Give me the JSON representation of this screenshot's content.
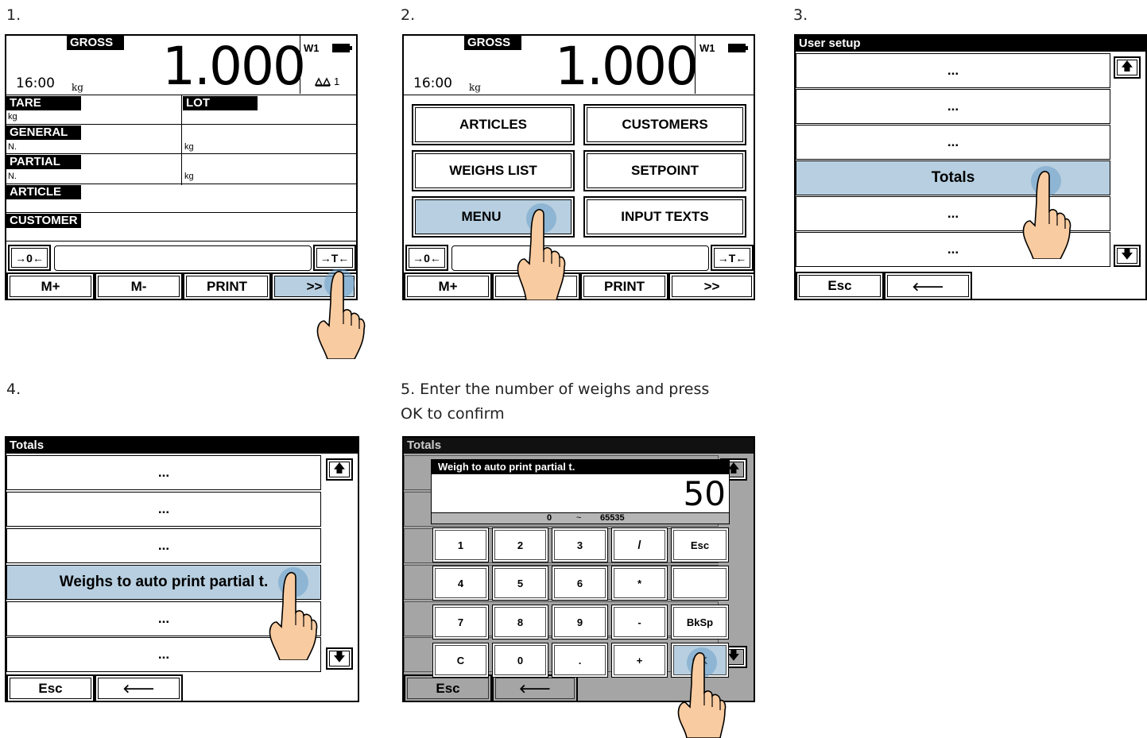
{
  "steps": {
    "s1": "1.",
    "s2": "2.",
    "s3": "3.",
    "s4": "4.",
    "s5_line1": "5. Enter the number of weighs and press",
    "s5_line2": "OK to confirm"
  },
  "screen1": {
    "gross_label": "GROSS",
    "weight": "1.000",
    "unit": "kg",
    "time": "16:00",
    "channel": "W1",
    "scale_number": "1",
    "tare_label": "TARE",
    "tare_unit": "kg",
    "lot_label": "LOT",
    "general_label": "GENERAL",
    "general_n": "N.",
    "general_kg": "kg",
    "partial_label": "PARTIAL",
    "partial_n": "N.",
    "partial_kg": "kg",
    "article_label": "ARTICLE",
    "customer_label": "CUSTOMER",
    "zero_btn": "→0←",
    "tare_btn": "→T←",
    "softkeys": [
      "M+",
      "M-",
      "PRINT",
      ">>"
    ]
  },
  "screen2": {
    "gross_label": "GROSS",
    "weight": "1.000",
    "unit": "kg",
    "time": "16:00",
    "channel": "W1",
    "menu_buttons": [
      "ARTICLES",
      "CUSTOMERS",
      "WEIGHS LIST",
      "SETPOINT",
      "MENU",
      "INPUT TEXTS"
    ],
    "zero_btn": "→0←",
    "tare_btn": "→T←",
    "softkeys": [
      "M+",
      "M",
      "PRINT",
      ">>"
    ]
  },
  "screen3": {
    "title": "User setup",
    "rows": [
      "...",
      "...",
      "...",
      "Totals",
      "...",
      "..."
    ],
    "esc": "Esc",
    "back": "🡐"
  },
  "screen4": {
    "title": "Totals",
    "rows": [
      "...",
      "...",
      "...",
      "Weighs to auto print partial t.",
      "...",
      "..."
    ],
    "esc": "Esc",
    "back": "🡐"
  },
  "screen5": {
    "title": "Totals",
    "dialog_title": "Weigh to auto print partial t.",
    "value": "50",
    "range_min": "0",
    "range_sep": "~",
    "range_max": "65535",
    "keys": [
      "1",
      "2",
      "3",
      "/",
      "Esc",
      "4",
      "5",
      "6",
      "*",
      "",
      "7",
      "8",
      "9",
      "-",
      "BkSp",
      "C",
      "0",
      ".",
      "+",
      "OK"
    ],
    "esc": "Esc",
    "back": "🡐"
  },
  "icons": {
    "up": "🡅",
    "down": "🡇",
    "battery": "battery-icon",
    "scale": "scale-icon",
    "hand": "tapping-hand-icon"
  },
  "colors": {
    "selected": "#b7cfe0",
    "tap": "#6ea0c8",
    "skin": "#f9cba0",
    "dim": "#a5a5a5"
  }
}
